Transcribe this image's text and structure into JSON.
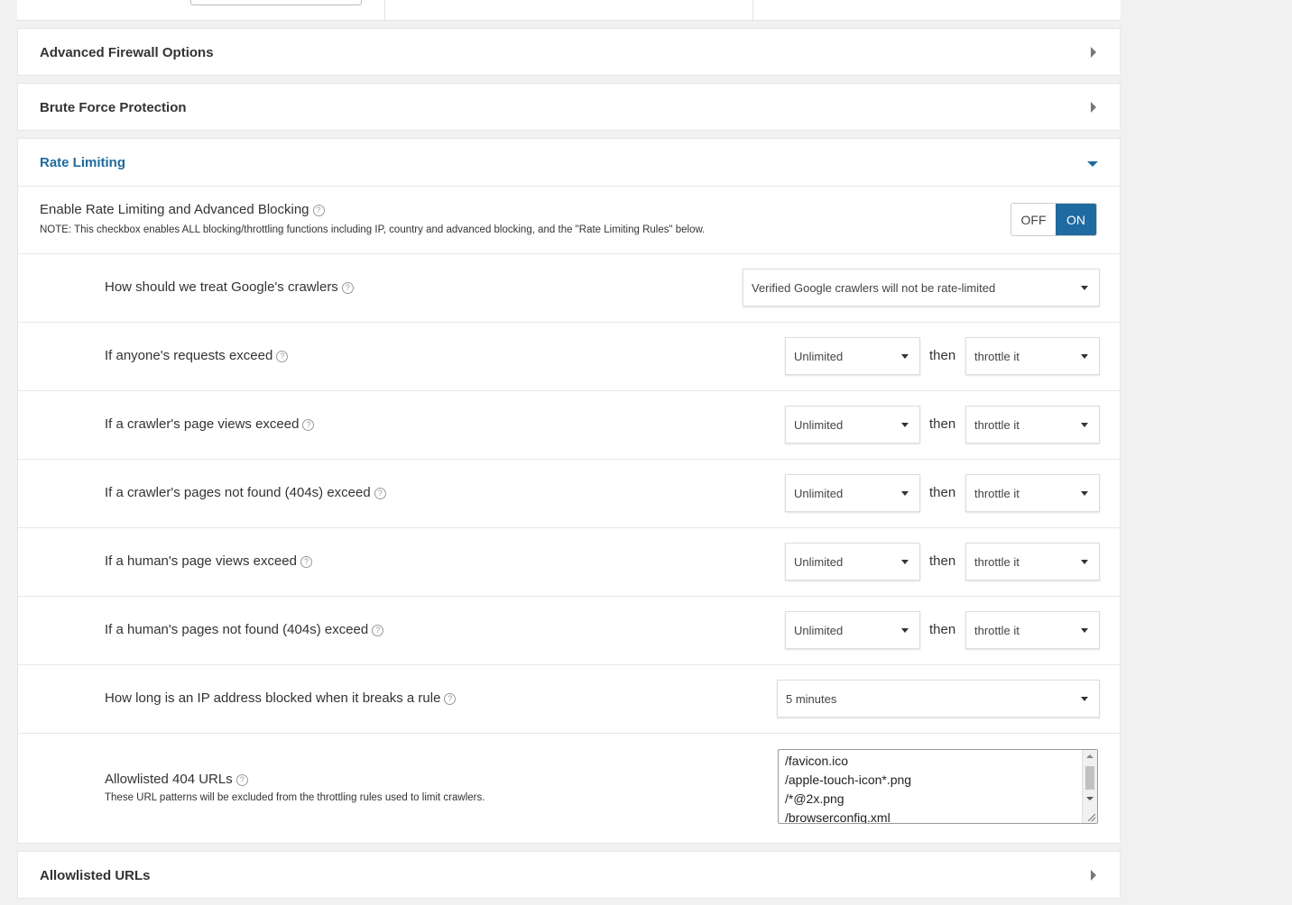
{
  "panels": {
    "advanced_firewall": "Advanced Firewall Options",
    "brute_force": "Brute Force Protection",
    "rate_limiting": "Rate Limiting",
    "allowlisted_urls": "Allowlisted URLs"
  },
  "rate_limiting": {
    "enable_label": "Enable Rate Limiting and Advanced Blocking",
    "enable_note": "NOTE: This checkbox enables ALL blocking/throttling functions including IP, country and advanced blocking, and the \"Rate Limiting Rules\" below.",
    "toggle_off": "OFF",
    "toggle_on": "ON",
    "google_label": "How should we treat Google's crawlers",
    "google_value": "Verified Google crawlers will not be rate-limited",
    "then_word": "then",
    "rules": [
      {
        "label": "If anyone's requests exceed",
        "limit": "Unlimited",
        "action": "throttle it"
      },
      {
        "label": "If a crawler's page views exceed",
        "limit": "Unlimited",
        "action": "throttle it"
      },
      {
        "label": "If a crawler's pages not found (404s) exceed",
        "limit": "Unlimited",
        "action": "throttle it"
      },
      {
        "label": "If a human's page views exceed",
        "limit": "Unlimited",
        "action": "throttle it"
      },
      {
        "label": "If a human's pages not found (404s) exceed",
        "limit": "Unlimited",
        "action": "throttle it"
      }
    ],
    "block_label": "How long is an IP address blocked when it breaks a rule",
    "block_value": "5 minutes",
    "allow404_label": "Allowlisted 404 URLs",
    "allow404_note": "These URL patterns will be excluded from the throttling rules used to limit crawlers.",
    "allow404_urls": [
      "/favicon.ico",
      "/apple-touch-icon*.png",
      "/*@2x.png",
      "/browserconfig.xml"
    ]
  },
  "help_glyph": "?",
  "colors": {
    "accent": "#1f6aa0",
    "background": "#f1f1f1"
  }
}
